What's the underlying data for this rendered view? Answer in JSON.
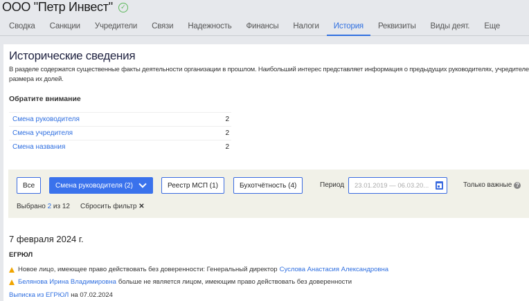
{
  "company": {
    "name": "ООО \"Петр Инвест\""
  },
  "tabs": [
    "Сводка",
    "Санкции",
    "Учредители",
    "Связи",
    "Надежность",
    "Финансы",
    "Налоги",
    "История",
    "Реквизиты",
    "Виды деят.",
    "Еще"
  ],
  "active_tab": "История",
  "section": {
    "title": "Исторические сведения",
    "description": "В разделе содержатся существенные факты деятельности организации в прошлом. Наибольший интерес представляет информация о предыдущих руководителях, учредителей и размера их долей.",
    "attention_title": "Обратите внимание",
    "items": [
      {
        "label": "Смена руководителя",
        "count": "2"
      },
      {
        "label": "Смена учредителя",
        "count": "2"
      },
      {
        "label": "Смена названия",
        "count": "2"
      }
    ]
  },
  "filters": {
    "all": "Все",
    "leader": "Смена руководителя (2)",
    "msp": "Реестр МСП (1)",
    "accounting": "Бухотчётность (4)",
    "period_label": "Период",
    "period_value": "23.01.2019 — 06.03.20...",
    "important": "Только важные",
    "selected_prefix": "Выбрано",
    "selected_count": "2",
    "selected_suffix": "из 12",
    "reset": "Сбросить фильтр"
  },
  "events": {
    "date": "7 февраля 2024 г.",
    "source": "ЕГРЮЛ",
    "e1_text": "Новое лицо, имеющее право действовать без доверенности: Генеральный директор",
    "e1_link": "Суслова Анастасия Александровна",
    "e2_link": "Белянова Ирина Владимировна",
    "e2_text": "больше не является лицом, имеющим право действовать без доверенности",
    "extract_link": "Выписка из ЕГРЮЛ",
    "extract_date": "на 07.02.2024"
  }
}
